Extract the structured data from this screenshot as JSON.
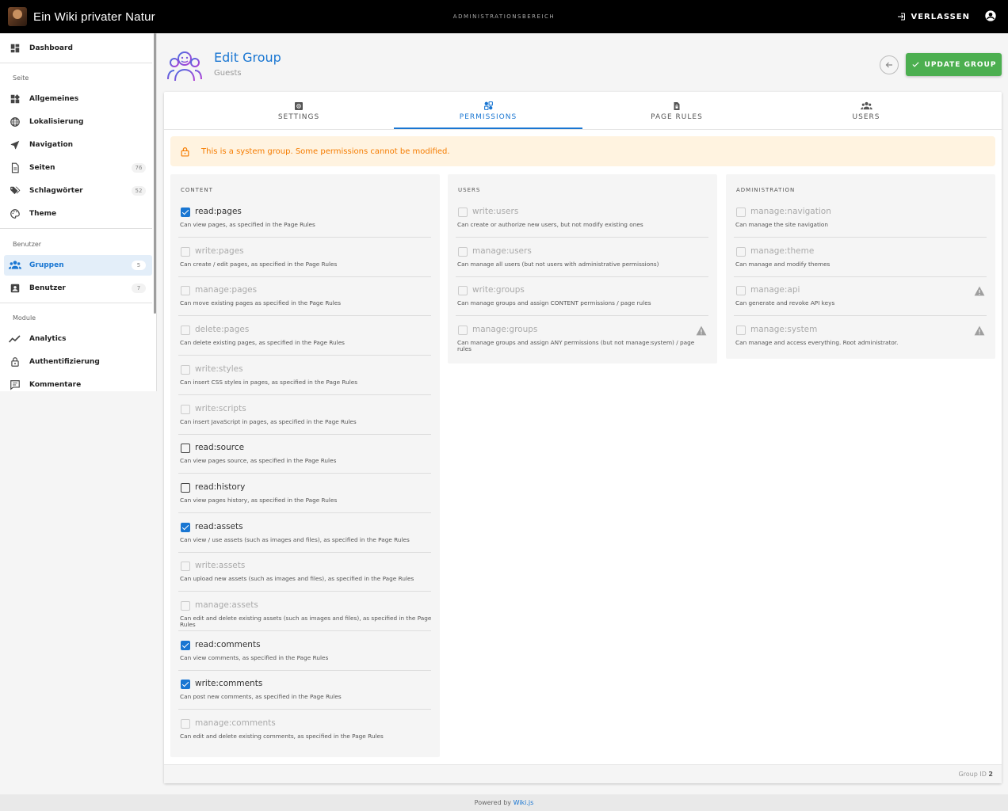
{
  "topbar": {
    "site_title": "Ein Wiki privater Natur",
    "area_label": "ADMINISTRATIONSBEREICH",
    "leave_label": "VERLASSEN"
  },
  "sidebar": {
    "dashboard": "Dashboard",
    "section_page": "Seite",
    "general": "Allgemeines",
    "localization": "Lokalisierung",
    "navigation": "Navigation",
    "pages": "Seiten",
    "pages_count": "76",
    "tags": "Schlagwörter",
    "tags_count": "52",
    "theme": "Theme",
    "section_users": "Benutzer",
    "groups": "Gruppen",
    "groups_count": "5",
    "users": "Benutzer",
    "users_count": "7",
    "section_modules": "Module",
    "analytics": "Analytics",
    "auth": "Authentifizierung",
    "comments": "Kommentare"
  },
  "header": {
    "title": "Edit Group",
    "subtitle": "Guests",
    "update_label": "UPDATE GROUP"
  },
  "tabs": {
    "settings": "SETTINGS",
    "permissions": "PERMISSIONS",
    "page_rules": "PAGE RULES",
    "users": "USERS"
  },
  "alert": "This is a system group. Some permissions cannot be modified.",
  "columns": {
    "content": {
      "title": "CONTENT",
      "perms": [
        {
          "name": "read:pages",
          "desc": "Can view pages, as specified in the Page Rules",
          "state": "checked"
        },
        {
          "name": "write:pages",
          "desc": "Can create / edit pages, as specified in the Page Rules",
          "state": "disabled"
        },
        {
          "name": "manage:pages",
          "desc": "Can move existing pages as specified in the Page Rules",
          "state": "disabled"
        },
        {
          "name": "delete:pages",
          "desc": "Can delete existing pages, as specified in the Page Rules",
          "state": "disabled"
        },
        {
          "name": "write:styles",
          "desc": "Can insert CSS styles in pages, as specified in the Page Rules",
          "state": "disabled"
        },
        {
          "name": "write:scripts",
          "desc": "Can insert JavaScript in pages, as specified in the Page Rules",
          "state": "disabled"
        },
        {
          "name": "read:source",
          "desc": "Can view pages source, as specified in the Page Rules",
          "state": "enabled"
        },
        {
          "name": "read:history",
          "desc": "Can view pages history, as specified in the Page Rules",
          "state": "enabled"
        },
        {
          "name": "read:assets",
          "desc": "Can view / use assets (such as images and files), as specified in the Page Rules",
          "state": "checked"
        },
        {
          "name": "write:assets",
          "desc": "Can upload new assets (such as images and files), as specified in the Page Rules",
          "state": "disabled"
        },
        {
          "name": "manage:assets",
          "desc": "Can edit and delete existing assets (such as images and files), as specified in the Page Rules",
          "state": "disabled"
        },
        {
          "name": "read:comments",
          "desc": "Can view comments, as specified in the Page Rules",
          "state": "checked"
        },
        {
          "name": "write:comments",
          "desc": "Can post new comments, as specified in the Page Rules",
          "state": "checked"
        },
        {
          "name": "manage:comments",
          "desc": "Can edit and delete existing comments, as specified in the Page Rules",
          "state": "disabled"
        }
      ]
    },
    "users": {
      "title": "USERS",
      "perms": [
        {
          "name": "write:users",
          "desc": "Can create or authorize new users, but not modify existing ones",
          "state": "disabled"
        },
        {
          "name": "manage:users",
          "desc": "Can manage all users (but not users with administrative permissions)",
          "state": "disabled"
        },
        {
          "name": "write:groups",
          "desc": "Can manage groups and assign CONTENT permissions / page rules",
          "state": "disabled"
        },
        {
          "name": "manage:groups",
          "desc": "Can manage groups and assign ANY permissions (but not manage:system) / page rules",
          "state": "disabled",
          "warn": true
        }
      ]
    },
    "admin": {
      "title": "ADMINISTRATION",
      "perms": [
        {
          "name": "manage:navigation",
          "desc": "Can manage the site navigation",
          "state": "disabled"
        },
        {
          "name": "manage:theme",
          "desc": "Can manage and modify themes",
          "state": "disabled"
        },
        {
          "name": "manage:api",
          "desc": "Can generate and revoke API keys",
          "state": "disabled",
          "warn": true
        },
        {
          "name": "manage:system",
          "desc": "Can manage and access everything. Root administrator.",
          "state": "disabled",
          "warn": true
        }
      ]
    }
  },
  "card_footer": {
    "label": "Group ID",
    "id": "2"
  },
  "footer": {
    "prefix": "Powered by",
    "link": "Wiki.js"
  }
}
